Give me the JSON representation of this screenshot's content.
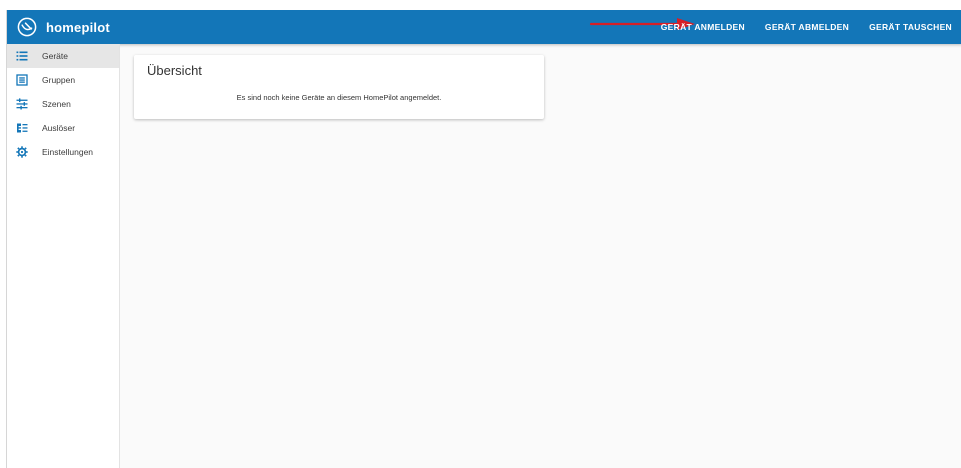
{
  "app": {
    "name": "homepilot"
  },
  "header": {
    "actions": [
      {
        "label": "GERÄT ANMELDEN"
      },
      {
        "label": "GERÄT ABMELDEN"
      },
      {
        "label": "GERÄT TAUSCHEN"
      }
    ]
  },
  "sidebar": {
    "items": [
      {
        "label": "Geräte",
        "icon": "list-icon",
        "active": true
      },
      {
        "label": "Gruppen",
        "icon": "group-icon",
        "active": false
      },
      {
        "label": "Szenen",
        "icon": "scenes-icon",
        "active": false
      },
      {
        "label": "Auslöser",
        "icon": "trigger-icon",
        "active": false
      },
      {
        "label": "Einstellungen",
        "icon": "gear-icon",
        "active": false
      }
    ]
  },
  "main": {
    "card": {
      "title": "Übersicht",
      "message": "Es sind noch keine Geräte an diesem HomePilot angemeldet."
    }
  },
  "colors": {
    "header": "#1376b8",
    "sidebar_icon": "#1376b8",
    "annotation_arrow": "#d61f26",
    "active_item_bg": "#e6e6e6"
  }
}
